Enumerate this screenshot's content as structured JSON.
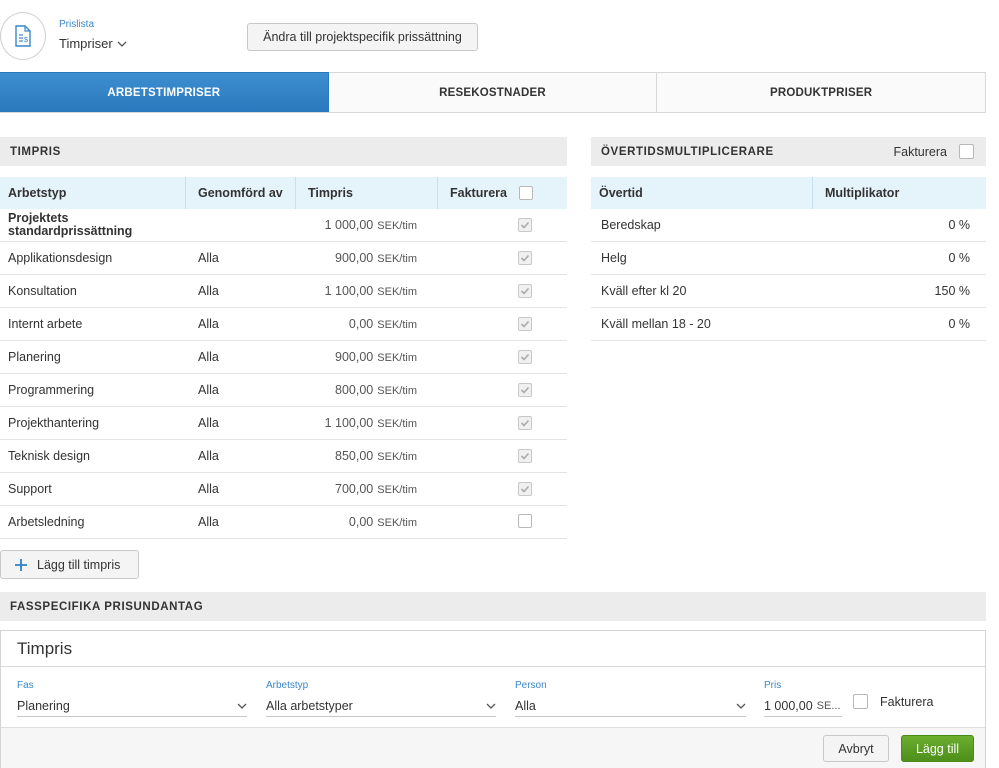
{
  "header": {
    "pricelist_label": "Prislista",
    "pricelist_value": "Timpriser",
    "change_button": "Ändra till projektspecifik prissättning"
  },
  "tabs": [
    {
      "label": "ARBETSTIMPRISER",
      "active": true
    },
    {
      "label": "RESEKOSTNADER",
      "active": false
    },
    {
      "label": "PRODUKTPRISER",
      "active": false
    }
  ],
  "timpris": {
    "title": "TIMPRIS",
    "columns": {
      "work_type": "Arbetstyp",
      "performed_by": "Genomförd av",
      "rate": "Timpris",
      "invoice": "Fakturera"
    },
    "rows": [
      {
        "work_type": "Projektets standardprissättning",
        "performed_by": "",
        "price": "1 000,00",
        "unit": "SEK/tim",
        "invoice": true,
        "bold": true
      },
      {
        "work_type": "Applikationsdesign",
        "performed_by": "Alla",
        "price": "900,00",
        "unit": "SEK/tim",
        "invoice": true
      },
      {
        "work_type": "Konsultation",
        "performed_by": "Alla",
        "price": "1 100,00",
        "unit": "SEK/tim",
        "invoice": true
      },
      {
        "work_type": "Internt arbete",
        "performed_by": "Alla",
        "price": "0,00",
        "unit": "SEK/tim",
        "invoice": true
      },
      {
        "work_type": "Planering",
        "performed_by": "Alla",
        "price": "900,00",
        "unit": "SEK/tim",
        "invoice": true
      },
      {
        "work_type": "Programmering",
        "performed_by": "Alla",
        "price": "800,00",
        "unit": "SEK/tim",
        "invoice": true
      },
      {
        "work_type": "Projekthantering",
        "performed_by": "Alla",
        "price": "1 100,00",
        "unit": "SEK/tim",
        "invoice": true
      },
      {
        "work_type": "Teknisk design",
        "performed_by": "Alla",
        "price": "850,00",
        "unit": "SEK/tim",
        "invoice": true
      },
      {
        "work_type": "Support",
        "performed_by": "Alla",
        "price": "700,00",
        "unit": "SEK/tim",
        "invoice": true
      },
      {
        "work_type": "Arbetsledning",
        "performed_by": "Alla",
        "price": "0,00",
        "unit": "SEK/tim",
        "invoice": false
      }
    ],
    "add_button": "Lägg till timpris"
  },
  "overtime": {
    "title": "ÖVERTIDSMULTIPLICERARE",
    "invoice_label": "Fakturera",
    "columns": {
      "overtime": "Övertid",
      "multiplier": "Multiplikator"
    },
    "rows": [
      {
        "name": "Beredskap",
        "value": "0 %"
      },
      {
        "name": "Helg",
        "value": "0 %"
      },
      {
        "name": "Kväll efter kl 20",
        "value": "150 %"
      },
      {
        "name": "Kväll mellan 18 - 20",
        "value": "0 %"
      }
    ]
  },
  "phase_exceptions": {
    "title": "FASSPECIFIKA PRISUNDANTAG",
    "panel_title": "Timpris",
    "fields": {
      "phase": {
        "label": "Fas",
        "value": "Planering"
      },
      "work_type": {
        "label": "Arbetstyp",
        "value": "Alla arbetstyper"
      },
      "person": {
        "label": "Person",
        "value": "Alla"
      },
      "price": {
        "label": "Pris",
        "value": "1 000,00",
        "unit": "SE..."
      }
    },
    "invoice_label": "Fakturera",
    "cancel_button": "Avbryt",
    "add_button": "Lägg till"
  },
  "colors": {
    "accent": "#2f80c5",
    "header_bg": "#e5f3fb",
    "success": "#5a9e24"
  }
}
